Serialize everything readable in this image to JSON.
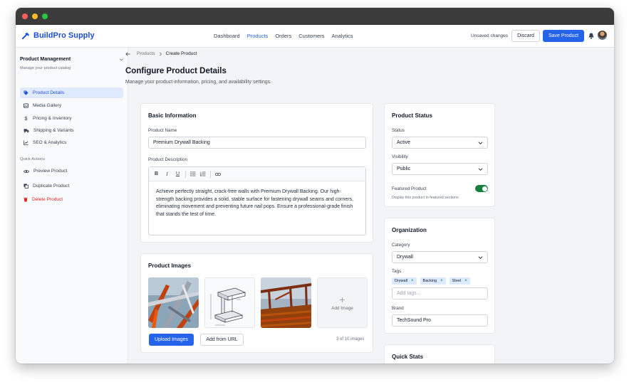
{
  "app": {
    "brand": "BuildPro Supply"
  },
  "nav": {
    "links": [
      "Dashboard",
      "Products",
      "Orders",
      "Customers",
      "Analytics"
    ],
    "active_index": 1
  },
  "header": {
    "unsaved": "Unsaved changes",
    "discard": "Discard",
    "save": "Save Product"
  },
  "sidebar": {
    "title": "Product Management",
    "subtitle": "Manage your product catalog",
    "items": [
      {
        "label": "Product Details",
        "icon": "tag-icon"
      },
      {
        "label": "Media Gallery",
        "icon": "image-icon"
      },
      {
        "label": "Pricing & Inventory",
        "icon": "dollar-icon"
      },
      {
        "label": "Shipping & Variants",
        "icon": "truck-icon"
      },
      {
        "label": "SEO & Analytics",
        "icon": "chart-icon"
      }
    ],
    "quick_actions_label": "Quick Actions",
    "actions": [
      {
        "label": "Preview Product",
        "icon": "eye-icon"
      },
      {
        "label": "Duplicate Product",
        "icon": "copy-icon"
      },
      {
        "label": "Delete Product",
        "icon": "trash-icon"
      }
    ]
  },
  "breadcrumb": {
    "parent": "Products",
    "current": "Create Product"
  },
  "page": {
    "title": "Configure Product Details",
    "subtitle": "Manage your product information, pricing, and availability settings."
  },
  "basic_info": {
    "title": "Basic Information",
    "name_label": "Product Name",
    "name_value": "Premium Drywall Backing",
    "desc_label": "Product Description",
    "toolbar": [
      "B",
      "I",
      "U"
    ],
    "description": "Achieve perfectly straight, crack-free walls with Premium Drywall Backing. Our high-strength backing provides a solid, stable surface for fastening drywall seams and corners, eliminating movement and preventing future nail pops. Ensure a professional-grade finish that stands the test of time."
  },
  "images": {
    "title": "Product Images",
    "add_label": "Add Image",
    "upload": "Upload Images",
    "from_url": "Add from URL",
    "count": "3 of 10 images"
  },
  "status": {
    "title": "Product Status",
    "status_label": "Status",
    "status_value": "Active",
    "visibility_label": "Visibility",
    "visibility_value": "Public",
    "featured_label": "Featured Product",
    "featured_hint": "Display this product in featured sections",
    "featured_on": true
  },
  "organization": {
    "title": "Organization",
    "category_label": "Category",
    "category_value": "Drywall",
    "tags_label": "Tags",
    "tags": [
      "Drywall",
      "Backing",
      "Steel"
    ],
    "tags_placeholder": "Add tags...",
    "brand_label": "Brand",
    "brand_value": "TechSound Pro"
  },
  "quick_stats": {
    "title": "Quick Stats"
  },
  "colors": {
    "accent": "#2563eb",
    "toggle": "#15803d",
    "danger": "#dc2626"
  }
}
